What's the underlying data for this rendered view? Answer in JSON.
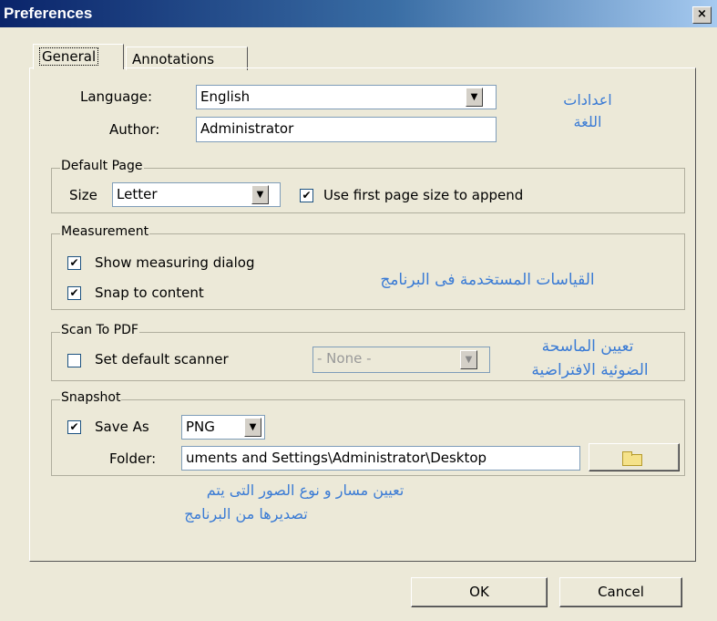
{
  "window": {
    "title": "Preferences",
    "close_glyph": "×"
  },
  "tabs": [
    {
      "label": "General",
      "selected": true
    },
    {
      "label": "Annotations",
      "selected": false
    }
  ],
  "general": {
    "language_label": "Language:",
    "language_value": "English",
    "author_label": "Author:",
    "author_value": "Administrator"
  },
  "default_page": {
    "title": "Default Page",
    "size_label": "Size",
    "size_value": "Letter",
    "use_first_label": "Use first page size to append",
    "use_first_checked": true
  },
  "measurement": {
    "title": "Measurement",
    "show_dialog_label": "Show measuring dialog",
    "show_dialog_checked": true,
    "snap_label": "Snap to content",
    "snap_checked": true
  },
  "scan": {
    "title": "Scan To PDF",
    "set_default_label": "Set default scanner",
    "set_default_checked": false,
    "scanner_value": "- None -"
  },
  "snapshot": {
    "title": "Snapshot",
    "save_as_label": "Save As",
    "save_as_checked": true,
    "format_value": "PNG",
    "folder_label": "Folder:",
    "folder_value": "uments and Settings\\Administrator\\Desktop"
  },
  "annotations": {
    "language_note_1": "اعدادات",
    "language_note_2": "اللغة",
    "measurement_note": "القياسات المستخدمة فى البرنامج",
    "scanner_note_1": "تعيين الماسحة",
    "scanner_note_2": "الضوئية الافتراضية",
    "snapshot_note_1": "تعيين مسار و نوع الصور التى يتم",
    "snapshot_note_2": "تصديرها من البرنامج"
  },
  "buttons": {
    "ok": "OK",
    "cancel": "Cancel"
  },
  "icons": {
    "check": "✔",
    "combo_arrow": "▼",
    "folder": "folder-icon"
  },
  "colors": {
    "title_bar": "#0a246a",
    "annotation_text": "#3a7bd5",
    "dialog_bg": "#ece9d8"
  }
}
